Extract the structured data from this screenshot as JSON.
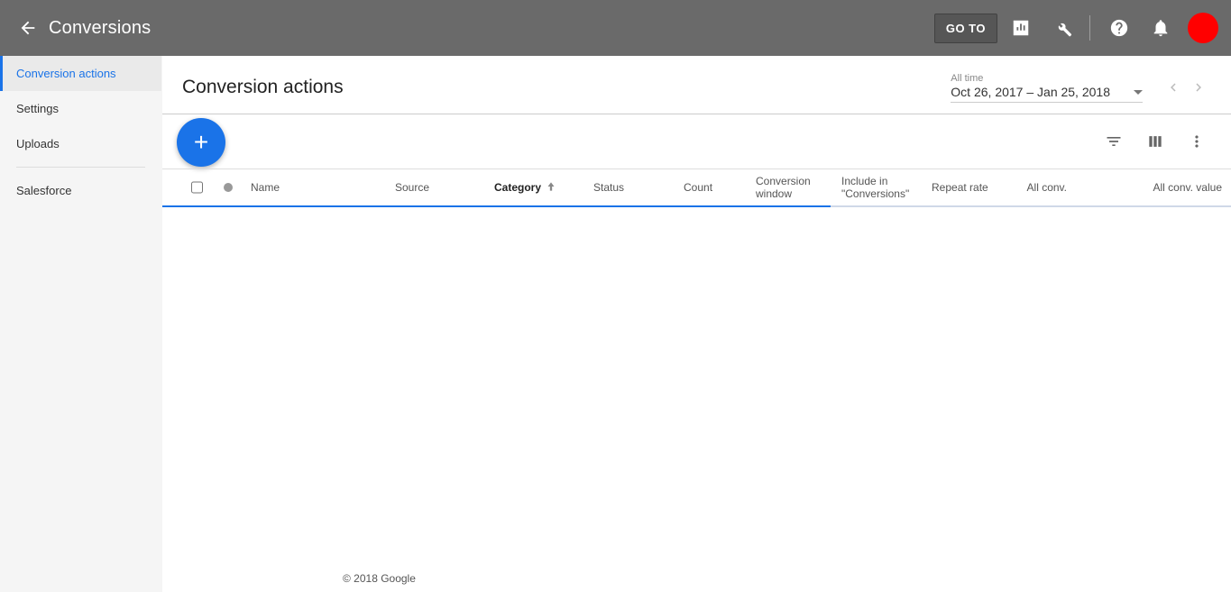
{
  "header": {
    "title": "Conversions",
    "goto_label": "GO TO"
  },
  "sidebar": {
    "items": [
      {
        "label": "Conversion actions",
        "active": true
      },
      {
        "label": "Settings",
        "active": false
      },
      {
        "label": "Uploads",
        "active": false
      },
      {
        "label": "Salesforce",
        "active": false
      }
    ]
  },
  "main": {
    "page_title": "Conversion actions",
    "date_label": "All time",
    "date_range": "Oct 26, 2017 – Jan 25, 2018",
    "fab_label": "+",
    "columns": {
      "name": "Name",
      "source": "Source",
      "category": "Category",
      "status": "Status",
      "count": "Count",
      "conversion_window": "Conversion window",
      "include_in": "Include in \"Conversions\"",
      "repeat_rate": "Repeat rate",
      "all_conv": "All conv.",
      "all_conv_value": "All conv. value"
    }
  },
  "footer": "© 2018 Google"
}
